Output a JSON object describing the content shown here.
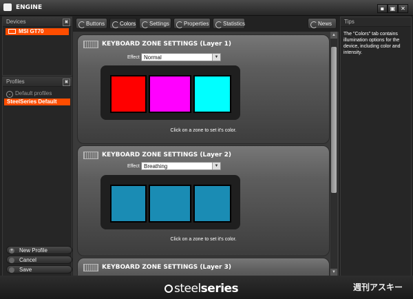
{
  "window": {
    "title": "ENGINE",
    "buttons": [
      "▪",
      "▣",
      "✕"
    ]
  },
  "devices": {
    "header": "Devices",
    "items": [
      {
        "label": "MSI GT70",
        "selected": true
      }
    ]
  },
  "profiles": {
    "header": "Profiles",
    "default_group": "Default profiles",
    "items": [
      {
        "label": "SteelSeries Default",
        "selected": true
      }
    ],
    "actions": {
      "new": "New Profile",
      "cancel": "Cancel",
      "save": "Save"
    }
  },
  "tabs": [
    {
      "label": "Buttons",
      "active": false
    },
    {
      "label": "Colors",
      "active": true
    },
    {
      "label": "Settings",
      "active": false
    },
    {
      "label": "Properties",
      "active": false
    },
    {
      "label": "Statistics",
      "active": false
    }
  ],
  "news": {
    "label": "News"
  },
  "tips": {
    "header": "Tips",
    "text": "The \"Colors\" tab contains illumination options for the device, including color and intensity."
  },
  "zones": [
    {
      "title": "KEYBOARD ZONE SETTINGS (Layer 1)",
      "effect_label": "Effect",
      "effect": "Normal",
      "colors": [
        "#ff0000",
        "#ff00ff",
        "#00ffff"
      ],
      "hint": "Click on a zone to set it's color."
    },
    {
      "title": "KEYBOARD ZONE SETTINGS (Layer 2)",
      "effect_label": "Effect",
      "effect": "Breathing",
      "colors": [
        "#1a8cb4",
        "#1a8cb4",
        "#1a8cb4"
      ],
      "hint": "Click on a zone to set it's color."
    },
    {
      "title": "KEYBOARD ZONE SETTINGS (Layer 3)"
    }
  ],
  "brand": {
    "prefix": "steel",
    "suffix": "series"
  },
  "watermark": "週刊アスキー",
  "theme": {
    "accent": "#ff4d00",
    "background": "#222222"
  }
}
